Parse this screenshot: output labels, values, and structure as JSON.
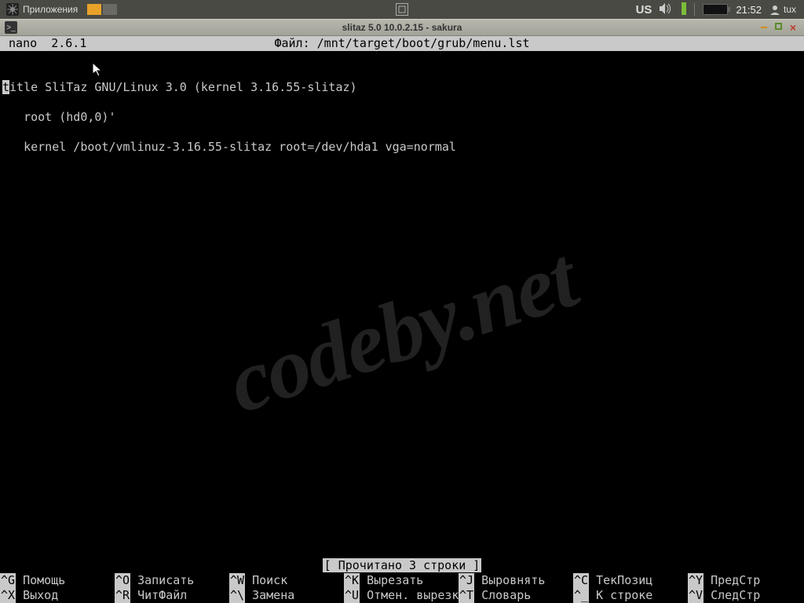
{
  "panel": {
    "apps_label": "Приложения",
    "keyboard": "US",
    "clock": "21:52",
    "user": "tux"
  },
  "window": {
    "title": "slitaz 5.0 10.0.2.15  - sakura"
  },
  "nano": {
    "version_label": " nano  2.6.1",
    "file_label": "Файл: /mnt/target/boot/grub/menu.lst",
    "status": "[ Прочитано 3 строки ]",
    "lines": {
      "l1_first": "t",
      "l1_rest": "itle SliTaz GNU/Linux 3.0 (kernel 3.16.55-slitaz)",
      "l2": "root (hd0,0)'",
      "l3": "kernel /boot/vmlinuz-3.16.55-slitaz root=/dev/hda1 vga=normal"
    },
    "shortcuts_row1": [
      {
        "key": "^G",
        "label": " Помощь"
      },
      {
        "key": "^O",
        "label": " Записать"
      },
      {
        "key": "^W",
        "label": " Поиск"
      },
      {
        "key": "^K",
        "label": " Вырезать"
      },
      {
        "key": "^J",
        "label": " Выровнять"
      },
      {
        "key": "^C",
        "label": " ТекПозиц"
      },
      {
        "key": "^Y",
        "label": " ПредСтр"
      }
    ],
    "shortcuts_row2": [
      {
        "key": "^X",
        "label": " Выход"
      },
      {
        "key": "^R",
        "label": " ЧитФайл"
      },
      {
        "key": "^\\",
        "label": " Замена"
      },
      {
        "key": "^U",
        "label": " Отмен. вырезк"
      },
      {
        "key": "^T",
        "label": " Словарь"
      },
      {
        "key": "^_",
        "label": " К строке"
      },
      {
        "key": "^V",
        "label": " СледСтр"
      }
    ]
  },
  "watermark": "codeby.net"
}
